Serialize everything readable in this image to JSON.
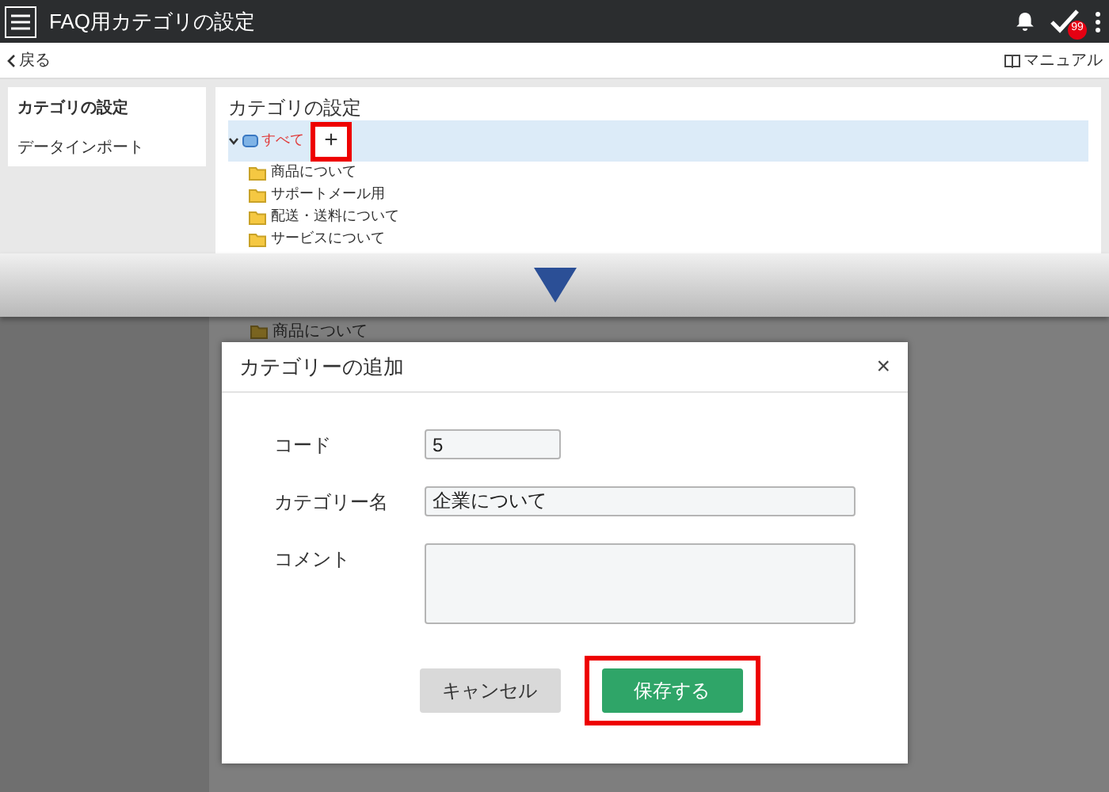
{
  "header": {
    "title": "FAQ用カテゴリの設定",
    "badge": "99"
  },
  "subbar": {
    "back": "戻る",
    "manual": "マニュアル"
  },
  "sidebar": {
    "items": [
      {
        "label": "カテゴリの設定",
        "selected": true
      },
      {
        "label": "データインポート",
        "selected": false
      }
    ]
  },
  "tree": {
    "title": "カテゴリの設定",
    "add_button": {
      "label": "+",
      "highlighted": true
    },
    "root": {
      "label": "すべて",
      "expanded": true,
      "selected": true,
      "children": [
        {
          "label": "商品について"
        },
        {
          "label": "サポートメール用"
        },
        {
          "label": "配送・送料について"
        },
        {
          "label": "サービスについて"
        }
      ]
    }
  },
  "background_tree": {
    "items": [
      {
        "label": "商品について"
      }
    ]
  },
  "dialog": {
    "title": "カテゴリーの追加",
    "close": "×",
    "fields": [
      {
        "kind": "input",
        "label": "コード",
        "value": "5"
      },
      {
        "kind": "wide_input",
        "label": "カテゴリー名",
        "value": "企業について"
      },
      {
        "kind": "textarea",
        "label": "コメント"
      }
    ],
    "buttons": [
      {
        "label": "キャンセル",
        "kind": "secondary",
        "highlighted": false
      },
      {
        "label": "保存する",
        "kind": "primary",
        "highlighted": true
      }
    ]
  }
}
